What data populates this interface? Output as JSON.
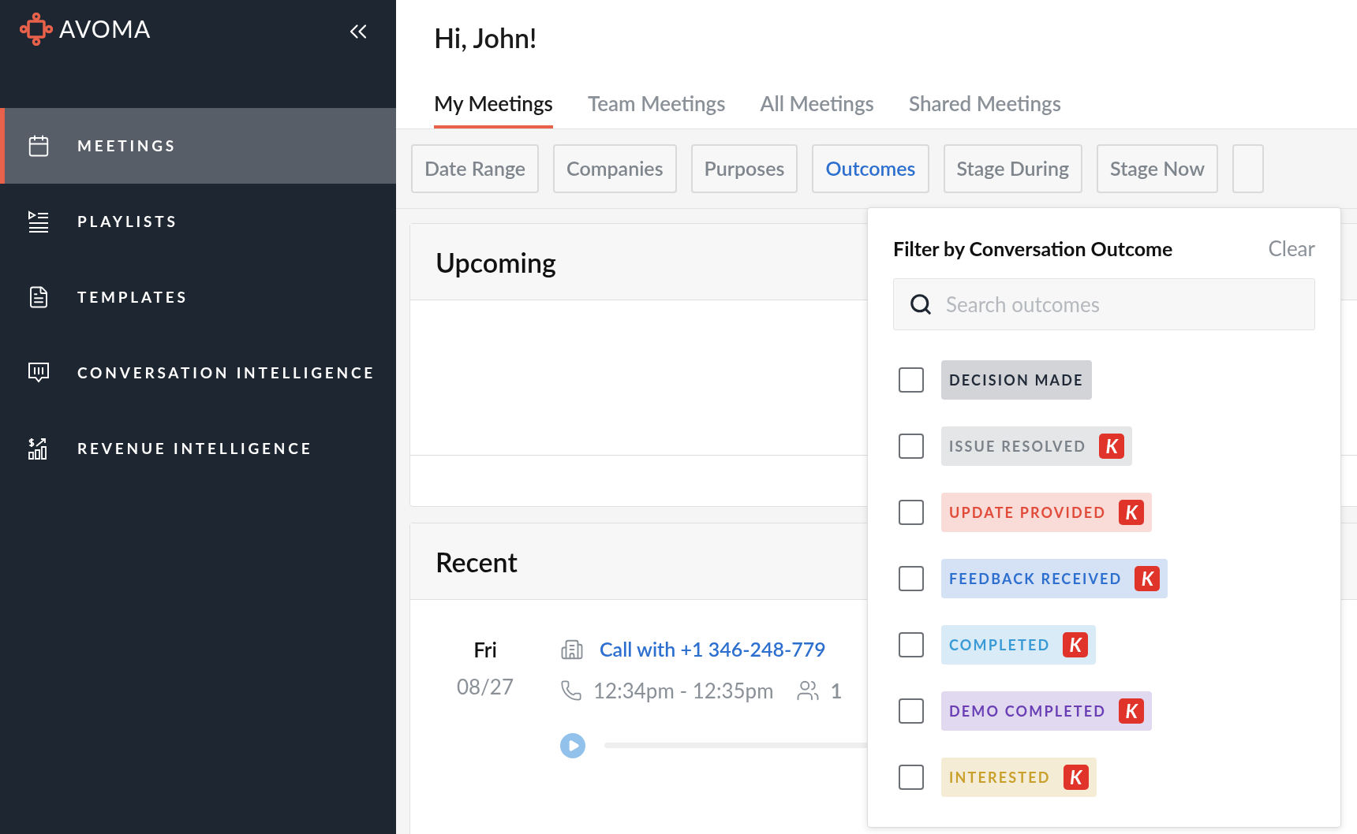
{
  "brand": {
    "name": "AVOMA"
  },
  "sidebar": {
    "items": [
      {
        "label": "MEETINGS",
        "kind": "calendar",
        "selected": true
      },
      {
        "label": "PLAYLISTS",
        "kind": "playlist",
        "selected": false
      },
      {
        "label": "TEMPLATES",
        "kind": "document",
        "selected": false
      },
      {
        "label": "CONVERSATION INTELLIGENCE",
        "kind": "speech",
        "selected": false
      },
      {
        "label": "REVENUE INTELLIGENCE",
        "kind": "revenue",
        "selected": false
      }
    ]
  },
  "greeting": "Hi, John!",
  "tabs": [
    {
      "label": "My Meetings",
      "selected": true
    },
    {
      "label": "Team Meetings",
      "selected": false
    },
    {
      "label": "All Meetings",
      "selected": false
    },
    {
      "label": "Shared Meetings",
      "selected": false
    }
  ],
  "filters": [
    {
      "label": "Date Range",
      "selected": false
    },
    {
      "label": "Companies",
      "selected": false
    },
    {
      "label": "Purposes",
      "selected": false
    },
    {
      "label": "Outcomes",
      "selected": true
    },
    {
      "label": "Stage During",
      "selected": false
    },
    {
      "label": "Stage Now",
      "selected": false
    }
  ],
  "upcoming": {
    "title": "Upcoming"
  },
  "recent": {
    "title": "Recent",
    "meeting": {
      "day": "Fri",
      "date": "08/27",
      "title": "Call with +1 346-248-779",
      "time": "12:34pm - 12:35pm",
      "attendees": "1"
    }
  },
  "outcome_filter": {
    "title": "Filter by Conversation Outcome",
    "clear": "Clear",
    "search": {
      "placeholder": "Search outcomes"
    },
    "options": [
      {
        "label": "DECISION MADE",
        "color": "#1f2937",
        "checked": false
      },
      {
        "label": "ISSUE RESOLVED",
        "color": "#7b8289",
        "checked": false,
        "badge": "K"
      },
      {
        "label": "UPDATE PROVIDED",
        "color": "#e04b3a",
        "checked": false,
        "badge": "K"
      },
      {
        "label": "FEEDBACK RECEIVED",
        "color": "#2d6fcf",
        "checked": false,
        "badge": "K"
      },
      {
        "label": "COMPLETED",
        "color": "#3a9ad6",
        "checked": false,
        "badge": "K"
      },
      {
        "label": "DEMO COMPLETED",
        "color": "#6a3fb5",
        "checked": false,
        "badge": "K"
      },
      {
        "label": "INTERESTED",
        "color": "#c9a02b",
        "checked": false,
        "badge": "K"
      }
    ]
  }
}
